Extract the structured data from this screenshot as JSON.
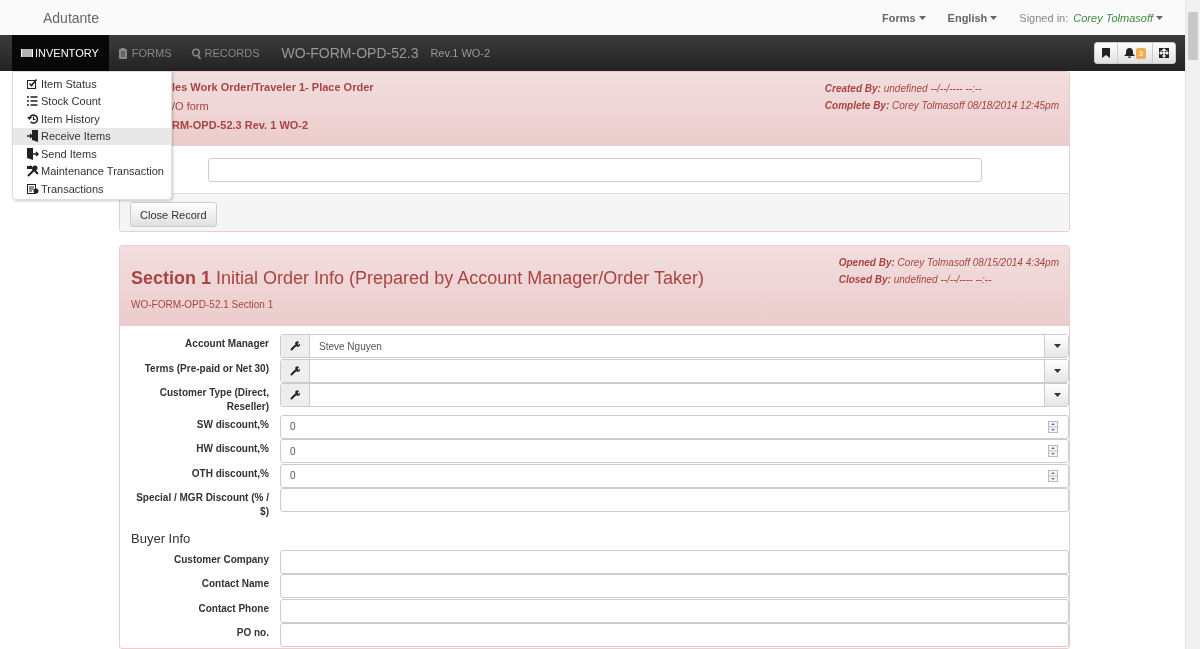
{
  "brand": "Adutante",
  "top_nav": [
    {
      "label": "Forms"
    },
    {
      "label": "English"
    }
  ],
  "user": {
    "prefix": "Signed in:",
    "name": "Corey Tolmasoff"
  },
  "navbar": {
    "tabs": [
      {
        "label": "INVENTORY",
        "selected": true
      },
      {
        "label": "FORMS",
        "selected": false
      },
      {
        "label": "RECORDS",
        "selected": false
      }
    ],
    "form_code": "WO-FORM-OPD-52.3",
    "revision": "Rev.1 WO-2",
    "buttons": [
      {
        "kind": "bookmark"
      },
      {
        "kind": "notifications",
        "badge": "3"
      },
      {
        "kind": "fullscreen"
      }
    ]
  },
  "inventory_menu": [
    {
      "label": "Item Status",
      "selected": false
    },
    {
      "label": "Stock Count",
      "selected": false
    },
    {
      "label": "Item History",
      "selected": false
    },
    {
      "label": "Receive Items",
      "selected": true
    },
    {
      "label": "Send Items",
      "selected": false
    },
    {
      "label": "Maintenance Transaction",
      "selected": false
    },
    {
      "label": "Transactions",
      "selected": false
    }
  ],
  "record": {
    "title": "les Work Order/Traveler 1- Place Order",
    "subtitle": "/O form",
    "code": "RM-OPD-52.3 Rev. 1 WO-2",
    "meta": [
      {
        "label": "Created By:",
        "value": "undefined --/--/---- --:--"
      },
      {
        "label": "Complete By:",
        "value": "Corey Tolmasoff 08/18/2014 12:45pm"
      }
    ],
    "close_button": "Close Record"
  },
  "section": {
    "title": "**Section 1** Initial Order Info (Prepared by Account Manager/Order Taker)",
    "code": "WO-FORM-OPD-52.1 Section 1",
    "meta": [
      {
        "label": "Opened By:",
        "value": "Corey Tolmasoff 08/15/2014 4:34pm"
      },
      {
        "label": "Closed By:",
        "value": "undefined --/--/---- --:--"
      }
    ],
    "fields": [
      {
        "kind": "select",
        "label": "Account Manager",
        "value": "Steve Nguyen"
      },
      {
        "kind": "select",
        "label": "Terms (Pre-paid or Net 30)"
      },
      {
        "kind": "select",
        "label": "Customer Type (Direct, Reseller)"
      },
      {
        "kind": "number",
        "label": "SW discount,%",
        "value": "0"
      },
      {
        "kind": "number",
        "label": "HW discount,%",
        "value": "0"
      },
      {
        "kind": "number",
        "label": "OTH discount,%",
        "value": "0"
      },
      {
        "kind": "text",
        "label": "Special / MGR Discount (% / $)"
      },
      {
        "kind": "heading",
        "label": "Buyer Info"
      },
      {
        "kind": "text",
        "label": "Customer Company"
      },
      {
        "kind": "text",
        "label": "Contact Name"
      },
      {
        "kind": "text",
        "label": "Contact Phone"
      },
      {
        "kind": "text",
        "label": "PO no."
      }
    ]
  }
}
